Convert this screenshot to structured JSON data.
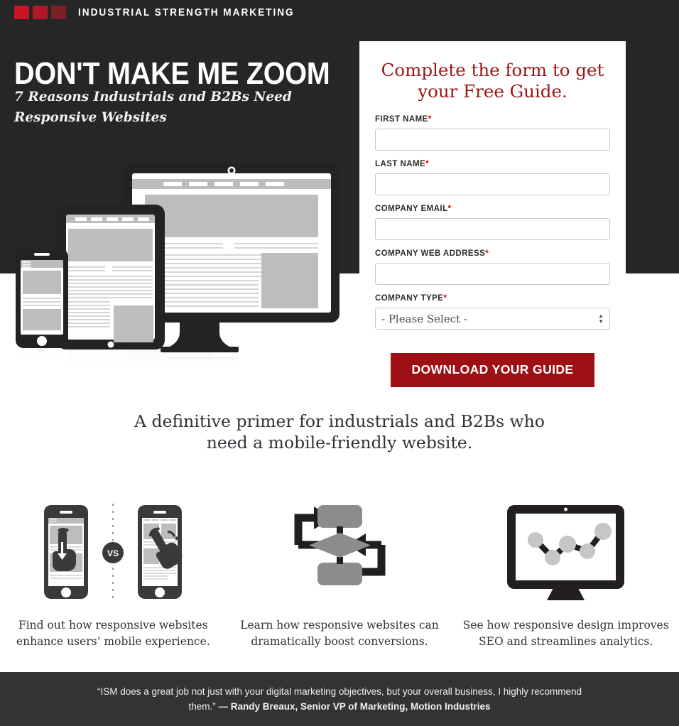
{
  "brand": {
    "name": "INDUSTRIAL STRENGTH MARKETING",
    "square_colors": [
      "#cc1427",
      "#b01728",
      "#7d1f27"
    ],
    "icon": "logo-squares"
  },
  "hero": {
    "headline": "DON'T MAKE ME ZOOM",
    "subhead": "7 Reasons Industrials and B2Bs Need Responsive Websites",
    "background": "#262626",
    "illustration": "responsive-devices-illustration"
  },
  "form": {
    "title": "Complete the form to get your Free Guide.",
    "title_color": "#9b1515",
    "fields": [
      {
        "label": "FIRST NAME",
        "required": "*",
        "value": "",
        "placeholder": "",
        "name": "first-name"
      },
      {
        "label": "LAST NAME",
        "required": "*",
        "value": "",
        "placeholder": "",
        "name": "last-name"
      },
      {
        "label": "COMPANY EMAIL",
        "required": "*",
        "value": "",
        "placeholder": "",
        "name": "company-email"
      },
      {
        "label": "COMPANY WEB ADDRESS",
        "required": "*",
        "value": "",
        "placeholder": "",
        "name": "company-web-address"
      }
    ],
    "select": {
      "label": "COMPANY TYPE",
      "required": "*",
      "selected": "- Please Select -"
    },
    "submit_label": "DOWNLOAD YOUR GUIDE",
    "submit_color": "#9d1015"
  },
  "primer": "A definitive primer for industrials and B2Bs who need a mobile-friendly website.",
  "features": [
    {
      "icon": "phones-vs-comparison-icon",
      "badge": "VS",
      "caption": "Find out how responsive websites enhance users’ mobile experience."
    },
    {
      "icon": "flowchart-conversion-icon",
      "caption": "Learn how responsive websites can dramatically boost conversions."
    },
    {
      "icon": "monitor-analytics-chart-icon",
      "caption": "See how responsive design improves SEO and streamlines analytics."
    }
  ],
  "footer": {
    "quote": "“ISM does a great job not just with your digital marketing objectives, but your overall business, I highly recommend them.”",
    "attribution": "— Randy Breaux, Senior VP of Marketing, Motion Industries",
    "background": "#333333"
  }
}
